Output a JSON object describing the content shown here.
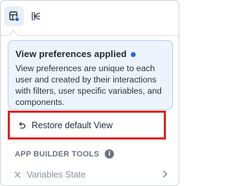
{
  "toolbar": {
    "view_button_icon": "view-preferences-icon",
    "filter_button_icon": "hierarchy-icon"
  },
  "info_card": {
    "title": "View preferences applied",
    "body": "View preferences are unique to each user and created by their interactions with filters, user specific variables, and components.",
    "dot_color": "#1f6fd6"
  },
  "restore": {
    "label": "Restore default View",
    "icon": "undo-icon",
    "highlight_color": "#e0201f"
  },
  "app_builder": {
    "section_title": "APP BUILDER TOOLS",
    "help_icon": "i",
    "items": [
      {
        "label": "Variables State",
        "icon": "variable-x-icon"
      }
    ]
  }
}
